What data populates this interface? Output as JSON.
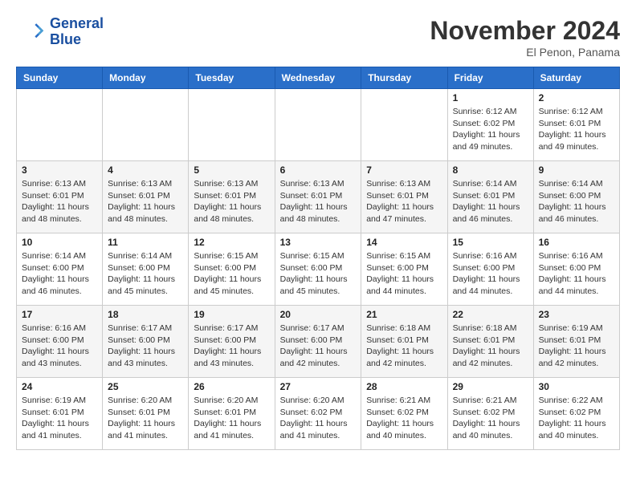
{
  "header": {
    "logo_line1": "General",
    "logo_line2": "Blue",
    "month": "November 2024",
    "location": "El Penon, Panama"
  },
  "weekdays": [
    "Sunday",
    "Monday",
    "Tuesday",
    "Wednesday",
    "Thursday",
    "Friday",
    "Saturday"
  ],
  "weeks": [
    [
      {
        "day": "",
        "info": ""
      },
      {
        "day": "",
        "info": ""
      },
      {
        "day": "",
        "info": ""
      },
      {
        "day": "",
        "info": ""
      },
      {
        "day": "",
        "info": ""
      },
      {
        "day": "1",
        "info": "Sunrise: 6:12 AM\nSunset: 6:02 PM\nDaylight: 11 hours\nand 49 minutes."
      },
      {
        "day": "2",
        "info": "Sunrise: 6:12 AM\nSunset: 6:01 PM\nDaylight: 11 hours\nand 49 minutes."
      }
    ],
    [
      {
        "day": "3",
        "info": "Sunrise: 6:13 AM\nSunset: 6:01 PM\nDaylight: 11 hours\nand 48 minutes."
      },
      {
        "day": "4",
        "info": "Sunrise: 6:13 AM\nSunset: 6:01 PM\nDaylight: 11 hours\nand 48 minutes."
      },
      {
        "day": "5",
        "info": "Sunrise: 6:13 AM\nSunset: 6:01 PM\nDaylight: 11 hours\nand 48 minutes."
      },
      {
        "day": "6",
        "info": "Sunrise: 6:13 AM\nSunset: 6:01 PM\nDaylight: 11 hours\nand 48 minutes."
      },
      {
        "day": "7",
        "info": "Sunrise: 6:13 AM\nSunset: 6:01 PM\nDaylight: 11 hours\nand 47 minutes."
      },
      {
        "day": "8",
        "info": "Sunrise: 6:14 AM\nSunset: 6:01 PM\nDaylight: 11 hours\nand 46 minutes."
      },
      {
        "day": "9",
        "info": "Sunrise: 6:14 AM\nSunset: 6:00 PM\nDaylight: 11 hours\nand 46 minutes."
      }
    ],
    [
      {
        "day": "10",
        "info": "Sunrise: 6:14 AM\nSunset: 6:00 PM\nDaylight: 11 hours\nand 46 minutes."
      },
      {
        "day": "11",
        "info": "Sunrise: 6:14 AM\nSunset: 6:00 PM\nDaylight: 11 hours\nand 45 minutes."
      },
      {
        "day": "12",
        "info": "Sunrise: 6:15 AM\nSunset: 6:00 PM\nDaylight: 11 hours\nand 45 minutes."
      },
      {
        "day": "13",
        "info": "Sunrise: 6:15 AM\nSunset: 6:00 PM\nDaylight: 11 hours\nand 45 minutes."
      },
      {
        "day": "14",
        "info": "Sunrise: 6:15 AM\nSunset: 6:00 PM\nDaylight: 11 hours\nand 44 minutes."
      },
      {
        "day": "15",
        "info": "Sunrise: 6:16 AM\nSunset: 6:00 PM\nDaylight: 11 hours\nand 44 minutes."
      },
      {
        "day": "16",
        "info": "Sunrise: 6:16 AM\nSunset: 6:00 PM\nDaylight: 11 hours\nand 44 minutes."
      }
    ],
    [
      {
        "day": "17",
        "info": "Sunrise: 6:16 AM\nSunset: 6:00 PM\nDaylight: 11 hours\nand 43 minutes."
      },
      {
        "day": "18",
        "info": "Sunrise: 6:17 AM\nSunset: 6:00 PM\nDaylight: 11 hours\nand 43 minutes."
      },
      {
        "day": "19",
        "info": "Sunrise: 6:17 AM\nSunset: 6:00 PM\nDaylight: 11 hours\nand 43 minutes."
      },
      {
        "day": "20",
        "info": "Sunrise: 6:17 AM\nSunset: 6:00 PM\nDaylight: 11 hours\nand 42 minutes."
      },
      {
        "day": "21",
        "info": "Sunrise: 6:18 AM\nSunset: 6:01 PM\nDaylight: 11 hours\nand 42 minutes."
      },
      {
        "day": "22",
        "info": "Sunrise: 6:18 AM\nSunset: 6:01 PM\nDaylight: 11 hours\nand 42 minutes."
      },
      {
        "day": "23",
        "info": "Sunrise: 6:19 AM\nSunset: 6:01 PM\nDaylight: 11 hours\nand 42 minutes."
      }
    ],
    [
      {
        "day": "24",
        "info": "Sunrise: 6:19 AM\nSunset: 6:01 PM\nDaylight: 11 hours\nand 41 minutes."
      },
      {
        "day": "25",
        "info": "Sunrise: 6:20 AM\nSunset: 6:01 PM\nDaylight: 11 hours\nand 41 minutes."
      },
      {
        "day": "26",
        "info": "Sunrise: 6:20 AM\nSunset: 6:01 PM\nDaylight: 11 hours\nand 41 minutes."
      },
      {
        "day": "27",
        "info": "Sunrise: 6:20 AM\nSunset: 6:02 PM\nDaylight: 11 hours\nand 41 minutes."
      },
      {
        "day": "28",
        "info": "Sunrise: 6:21 AM\nSunset: 6:02 PM\nDaylight: 11 hours\nand 40 minutes."
      },
      {
        "day": "29",
        "info": "Sunrise: 6:21 AM\nSunset: 6:02 PM\nDaylight: 11 hours\nand 40 minutes."
      },
      {
        "day": "30",
        "info": "Sunrise: 6:22 AM\nSunset: 6:02 PM\nDaylight: 11 hours\nand 40 minutes."
      }
    ]
  ]
}
